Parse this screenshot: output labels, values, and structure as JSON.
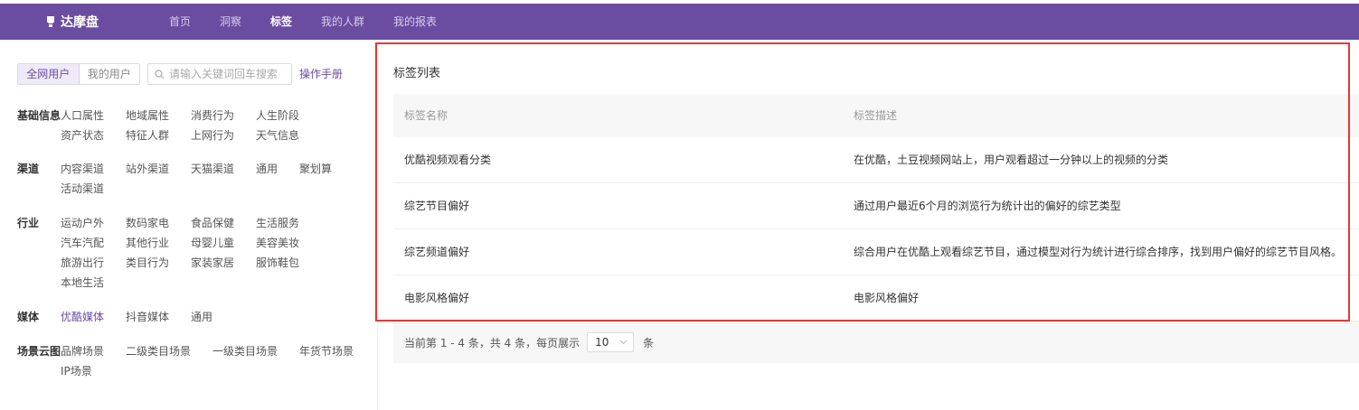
{
  "brand": {
    "name": "达摩盘",
    "icon": "logo-icon",
    "nav_bg": "#6a4ca0"
  },
  "nav": [
    {
      "label": "首页"
    },
    {
      "label": "洞察"
    },
    {
      "label": "标签",
      "active": true
    },
    {
      "label": "我的人群"
    },
    {
      "label": "我的报表"
    }
  ],
  "sidebar": {
    "scope": [
      {
        "label": "全网用户",
        "active": true
      },
      {
        "label": "我的用户"
      }
    ],
    "search": {
      "placeholder": "请输入关键词回车搜索",
      "value": "",
      "icon": "search-icon"
    },
    "manual": "操作手册",
    "categories": [
      {
        "title": "基础信息",
        "items": [
          "人口属性",
          "地域属性",
          "消费行为",
          "人生阶段",
          "资产状态",
          "特征人群",
          "上网行为",
          "天气信息"
        ]
      },
      {
        "title": "渠道",
        "items": [
          "内容渠道",
          "站外渠道",
          "天猫渠道",
          "通用",
          "聚划算",
          "活动渠道"
        ]
      },
      {
        "title": "行业",
        "items": [
          "运动户外",
          "数码家电",
          "食品保健",
          "生活服务",
          "汽车汽配",
          "其他行业",
          "母婴儿童",
          "美容美妆",
          "旅游出行",
          "类目行为",
          "家装家居",
          "服饰鞋包",
          "本地生活"
        ]
      },
      {
        "title": "媒体",
        "items": [
          "优酷媒体",
          "抖音媒体",
          "通用"
        ],
        "active_item": 0
      },
      {
        "title": "场景云图",
        "items": [
          "品牌场景",
          "二级类目场景",
          "一级类目场景",
          "年货节场景",
          "IP场景"
        ]
      }
    ]
  },
  "panel": {
    "title": "标签列表",
    "columns": [
      "标签名称",
      "标签描述"
    ],
    "rows": [
      {
        "name": "优酷视频观看分类",
        "desc": "在优酷，土豆视频网站上，用户观看超过一分钟以上的视频的分类"
      },
      {
        "name": "综艺节目偏好",
        "desc": "通过用户最近6个月的浏览行为统计出的偏好的综艺类型"
      },
      {
        "name": "综艺频道偏好",
        "desc": "综合用户在优酷上观看综艺节目，通过模型对行为统计进行综合排序，找到用户偏好的综艺节目风格。"
      },
      {
        "name": "电影风格偏好",
        "desc": "电影风格偏好"
      }
    ],
    "pager": {
      "summary": "当前第 1 - 4 条，共 4 条，每页展示",
      "page_size": "10",
      "unit": "条",
      "icon": "chevron-down-icon"
    }
  },
  "highlight_color": "#e53935"
}
